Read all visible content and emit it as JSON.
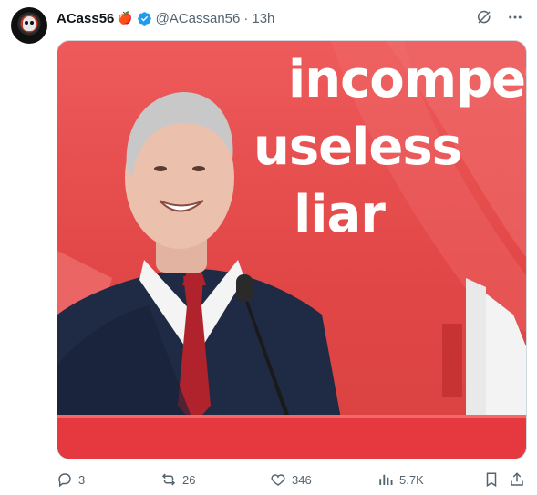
{
  "tweet": {
    "author_name": "ACass56",
    "handle": "@ACassan56",
    "separator": "·",
    "time": "13h"
  },
  "icons": {
    "name_emoji": "🍎",
    "verified": "verified-badge-icon",
    "grok": "grok-icon",
    "more": "more-icon"
  },
  "media": {
    "overlay_lines": [
      "incompetent",
      "useless",
      "liar"
    ]
  },
  "metrics": {
    "replies": "3",
    "reposts": "26",
    "likes": "346",
    "views": "5.7K"
  },
  "colors": {
    "brand_blue": "#1d9bf0",
    "muted": "#536471",
    "stage_red": "#e24747"
  }
}
